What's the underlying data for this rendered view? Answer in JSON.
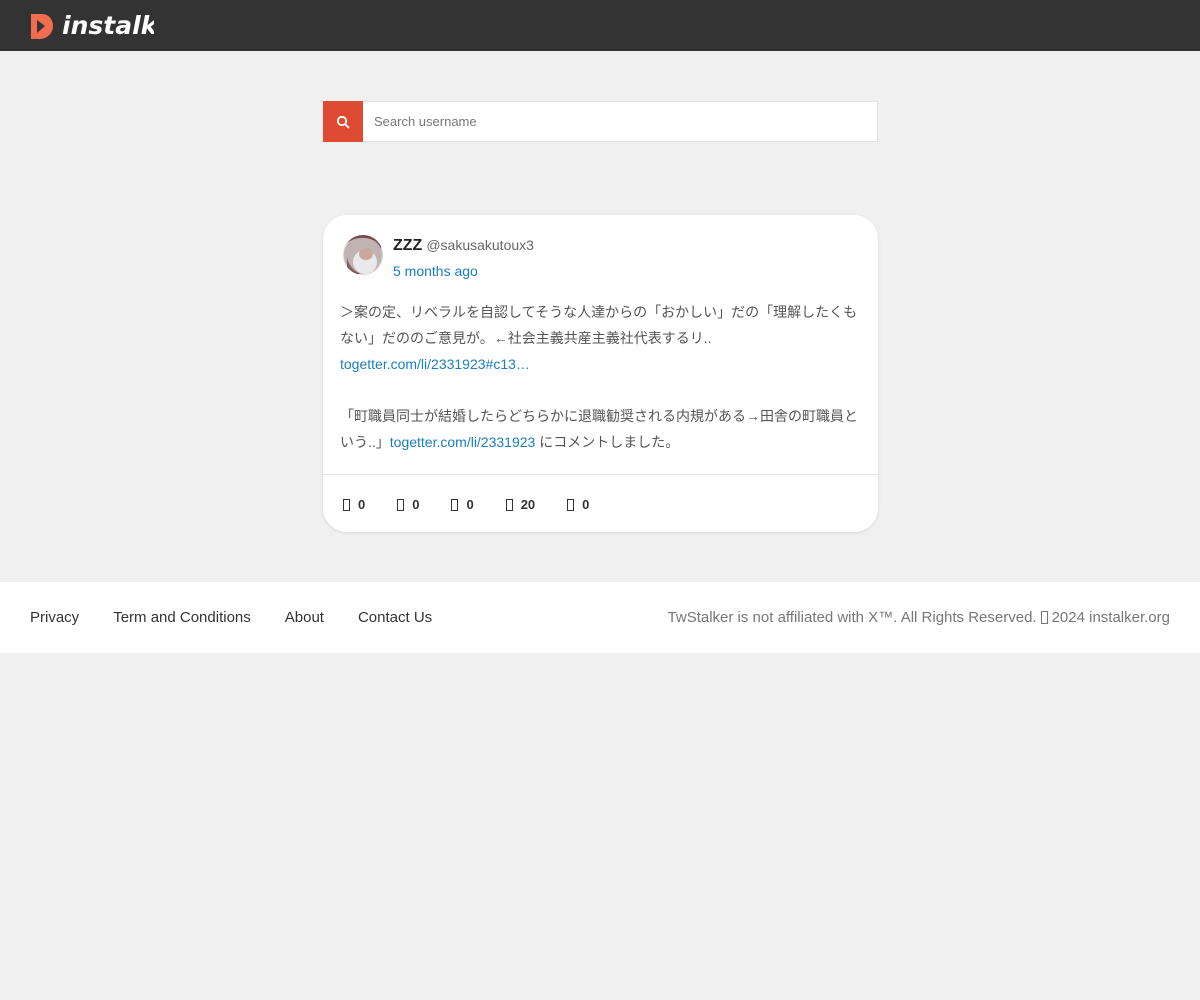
{
  "brand": {
    "name": "instalker",
    "accent_color": "#f26c4f"
  },
  "search": {
    "placeholder": "Search username",
    "value": "",
    "button_icon": "search-icon",
    "button_color": "#df4a32"
  },
  "post": {
    "display_name": "ZZZ",
    "handle": "@sakusakutoux3",
    "time": "5 months ago",
    "paragraph1": "＞案の定、リベラルを自認してそうな人達からの「おかしい」だの「理解したくもない」だののご意見が。←社会主義共産主義社代表するリ..",
    "link1": "togetter.com/li/2331923#c13…",
    "paragraph2_prefix": "「町職員同士が結婚したらどちらかに退職勧奨される内規がある→田舎の町職員という..」",
    "link2": "togetter.com/li/2331923",
    "paragraph2_suffix": " にコメントしました。",
    "link_color": "#1a7fc1",
    "stats": [
      {
        "icon": "reply-icon",
        "value": "0"
      },
      {
        "icon": "retweet-icon",
        "value": "0"
      },
      {
        "icon": "quote-icon",
        "value": "0"
      },
      {
        "icon": "heart-icon",
        "value": "20"
      },
      {
        "icon": "bookmark-icon",
        "value": "0"
      }
    ]
  },
  "footer": {
    "links": [
      "Privacy",
      "Term and Conditions",
      "About",
      "Contact Us"
    ],
    "copyright_prefix": "TwStalker is not affiliated with X™. All Rights Reserved.",
    "copyright_suffix": "2024 instalker.org"
  }
}
